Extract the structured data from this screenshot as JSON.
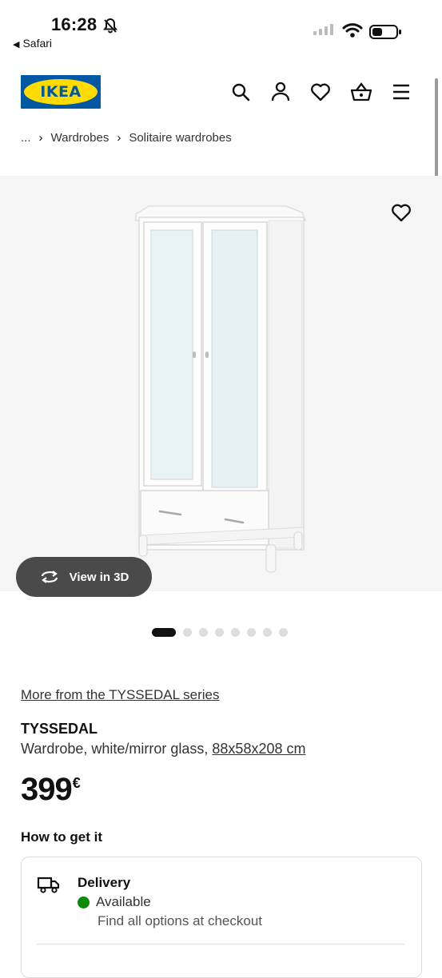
{
  "status_bar": {
    "time": "16:28",
    "back_app": "Safari"
  },
  "header": {
    "logo_text": "IKEA",
    "icons": [
      "search-icon",
      "user-icon",
      "heart-icon",
      "basket-icon",
      "menu-icon"
    ]
  },
  "breadcrumb": {
    "ellipsis": "...",
    "items": [
      "Wardrobes",
      "Solitaire wardrobes"
    ]
  },
  "gallery": {
    "view3d_label": "View in 3D",
    "image_count": 8,
    "active_index": 0
  },
  "product": {
    "series_link": "More from the TYSSEDAL series",
    "name": "TYSSEDAL",
    "description": "Wardrobe, white/mirror glass, ",
    "dimensions": "88x58x208 cm",
    "price": "399",
    "currency": "€"
  },
  "fulfilment": {
    "heading": "How to get it",
    "delivery_title": "Delivery",
    "delivery_status": "Available",
    "delivery_note": "Find all options at checkout"
  },
  "colors": {
    "ikea_blue": "#0058a3",
    "ikea_yellow": "#ffdb00",
    "available_green": "#0a8a00",
    "view3d_bg": "#4a4a4a"
  }
}
